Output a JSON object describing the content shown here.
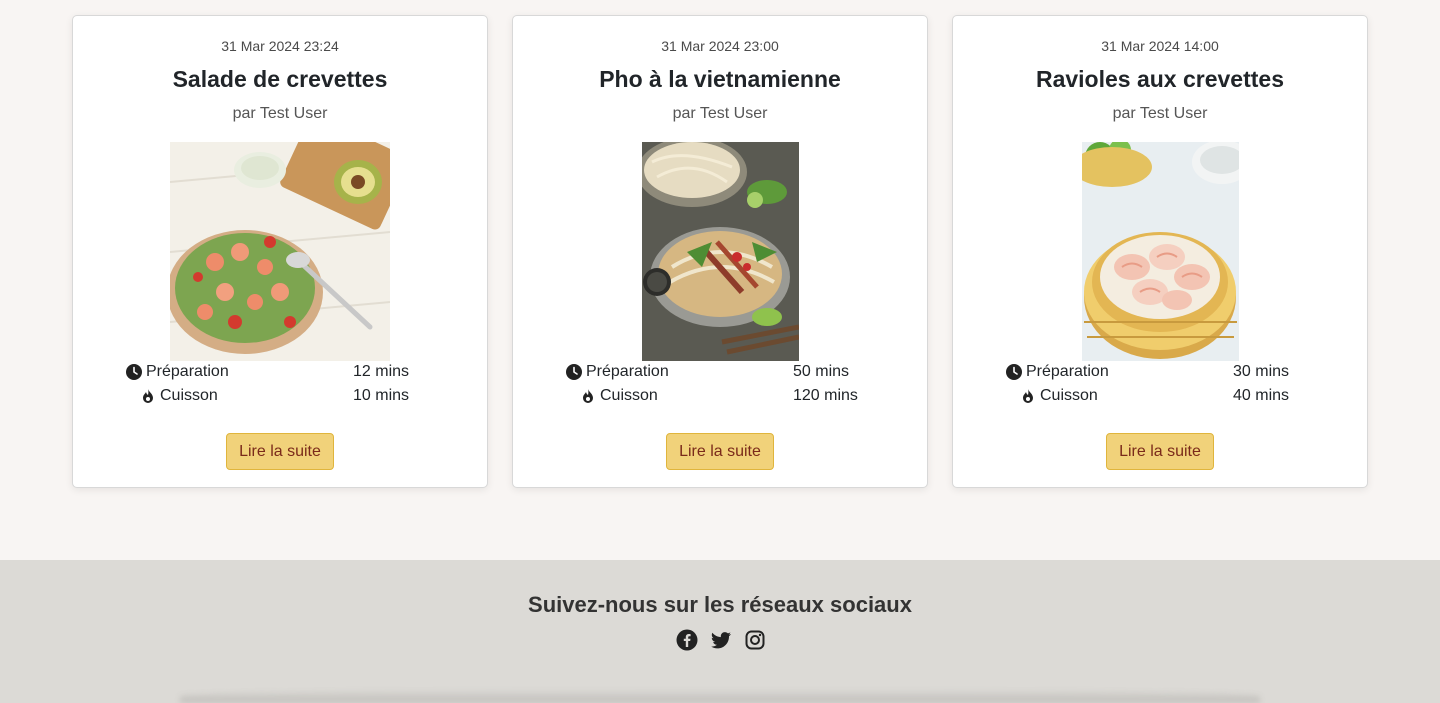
{
  "cards": [
    {
      "date": "31 Mar 2024 23:24",
      "title": "Salade de crevettes",
      "author": "par Test User",
      "prep_label": "Préparation",
      "prep_value": "12 mins",
      "cook_label": "Cuisson",
      "cook_value": "10 mins",
      "button": "Lire la suite"
    },
    {
      "date": "31 Mar 2024 23:00",
      "title": "Pho à la vietnamienne",
      "author": "par Test User",
      "prep_label": "Préparation",
      "prep_value": "50 mins",
      "cook_label": "Cuisson",
      "cook_value": "120 mins",
      "button": "Lire la suite"
    },
    {
      "date": "31 Mar 2024 14:00",
      "title": "Ravioles aux crevettes",
      "author": "par Test User",
      "prep_label": "Préparation",
      "prep_value": "30 mins",
      "cook_label": "Cuisson",
      "cook_value": "40 mins",
      "button": "Lire la suite"
    }
  ],
  "footer": {
    "title": "Suivez-nous sur les réseaux sociaux",
    "socials": [
      "facebook-icon",
      "twitter-icon",
      "instagram-icon"
    ]
  },
  "colors": {
    "page_bg": "#f8f5f3",
    "button_bg": "#f1d27a",
    "button_border": "#e0b53c",
    "button_text": "#7a2a1a",
    "footer_bg": "#dcdad6"
  }
}
